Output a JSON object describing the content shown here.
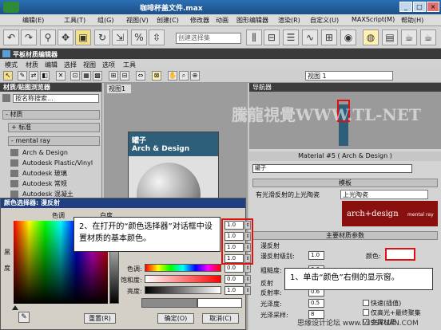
{
  "window": {
    "title": "咖啡杯盖文件.max",
    "buttons": [
      "_",
      "□",
      "×"
    ]
  },
  "menu": [
    "编辑(E)",
    "工具(T)",
    "组(G)",
    "视图(V)",
    "创建(C)",
    "修改器",
    "动画",
    "图形编辑器",
    "渲染(R)",
    "自定义(U)",
    "MAXScript(M)",
    "帮助(H)"
  ],
  "toolbar": {
    "selection_set_placeholder": "创建选择集"
  },
  "slate": {
    "title": "平板材质编辑器",
    "menu": [
      "模式",
      "材质",
      "编辑",
      "选择",
      "视图",
      "选项",
      "工具"
    ],
    "view_dropdown": "视图 1",
    "left_header": "材质/贴图浏览器",
    "search_placeholder": "按名称搜索...",
    "rollouts": [
      "- 材质",
      "+ 标准",
      "- mental ray"
    ],
    "library_items": [
      "Arch & Design",
      "Autodesk Plastic/Vinyl",
      "Autodesk 玻璃",
      "Autodesk 常规",
      "Autodesk 混凝土"
    ],
    "view_tab": "视图1",
    "navigator_label": "导航器",
    "node": {
      "name": "罐子",
      "type": "Arch & Design"
    }
  },
  "material_panel": {
    "header": "Material #5 ( Arch & Design )",
    "name_value": "罐子",
    "template_rollout": "模板",
    "template_desc": "有光滑反射的上光陶瓷",
    "template_select": "上光陶瓷",
    "logo_text": "arch+design",
    "logo_sub": "mental ray",
    "main_params": "主要材质参数",
    "diffuse_group": "漫反射",
    "diffuse_level_label": "漫反射级别:",
    "diffuse_level_value": "1.0",
    "color_label": "颜色:",
    "roughness_label": "粗糙度:",
    "roughness_value": "0.0",
    "reflection_label": "反射",
    "reflectivity_label": "反射率:",
    "reflectivity_value": "0.6",
    "gloss_label": "光泽度:",
    "gloss_value": "0.5",
    "fast_label": "快速(插值)",
    "highlight_label": "仅高光+最终聚集",
    "metal_label": "金属材质",
    "gloss_samples_label": "光泽采样:",
    "gloss_samples_value": "8"
  },
  "color_dialog": {
    "title": "颜色选择器: 漫反射",
    "hue_label": "色调",
    "whiteness_label": "白度",
    "blackness_label": "黑",
    "degree_label": "度",
    "rows": [
      {
        "label": "红:",
        "value": "1.0"
      },
      {
        "label": "绿:",
        "value": "1.0"
      },
      {
        "label": "蓝:",
        "value": "1.0"
      },
      {
        "label": "Alpha:",
        "value": "1.0"
      },
      {
        "label": "色调:",
        "value": "0.0"
      },
      {
        "label": "饱和度:",
        "value": "0.0"
      },
      {
        "label": "亮度:",
        "value": "1.0"
      }
    ],
    "reset_label": "重置(R)",
    "ok_label": "确定(O)",
    "cancel_label": "取消(C)"
  },
  "callouts": {
    "step1": "1、单击“颜色”右侧的显示窗。",
    "step2": "2、在打开的“颜色选择器”对话框中设置材质的基本颜色。"
  },
  "watermark": "騰龍視覺WWW.TL-NET",
  "bottom_watermark": "思缘设计论坛 www.MISSYUAN.COM",
  "colors": {
    "accent_red": "#e01010",
    "node_header": "#2e5f7a",
    "dialog_title": "#1f3f82"
  }
}
